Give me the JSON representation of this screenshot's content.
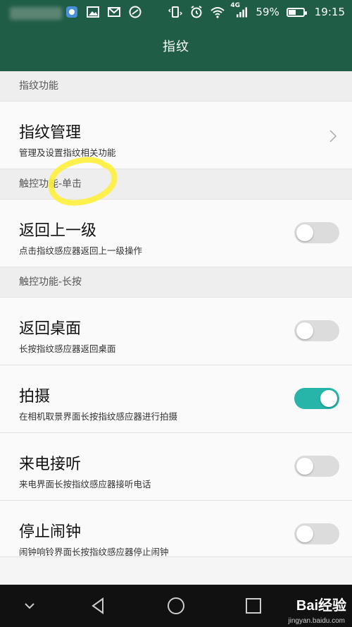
{
  "status_bar": {
    "network": "4G",
    "battery_percent": "59%",
    "battery_level": 0.59,
    "time": "19:15"
  },
  "header": {
    "title": "指纹"
  },
  "sections": [
    {
      "header": "指纹功能",
      "items": [
        {
          "title": "指纹管理",
          "subtitle": "管理及设置指纹相关功能",
          "control": "chevron"
        }
      ]
    },
    {
      "header": "触控功能-单击",
      "items": [
        {
          "title": "返回上一级",
          "subtitle": "点击指纹感应器返回上一级操作",
          "control": "toggle",
          "on": false
        }
      ]
    },
    {
      "header": "触控功能-长按",
      "items": [
        {
          "title": "返回桌面",
          "subtitle": "长按指纹感应器返回桌面",
          "control": "toggle",
          "on": false
        },
        {
          "title": "拍摄",
          "subtitle": "在相机取景界面长按指纹感应器进行拍摄",
          "control": "toggle",
          "on": true
        },
        {
          "title": "来电接听",
          "subtitle": "来电界面长按指纹感应器接听电话",
          "control": "toggle",
          "on": false
        },
        {
          "title": "停止闹钟",
          "subtitle": "闹钟响铃界面长按指纹感应器停止闹钟",
          "control": "toggle",
          "on": false
        }
      ]
    }
  ],
  "nav_bar": {
    "watermark": "Bai经验",
    "watermark_url": "jingyan.baidu.com"
  },
  "colors": {
    "header_bg": "#1f5d46",
    "toggle_on": "#26b5a8",
    "highlight": "#ffef3a"
  }
}
